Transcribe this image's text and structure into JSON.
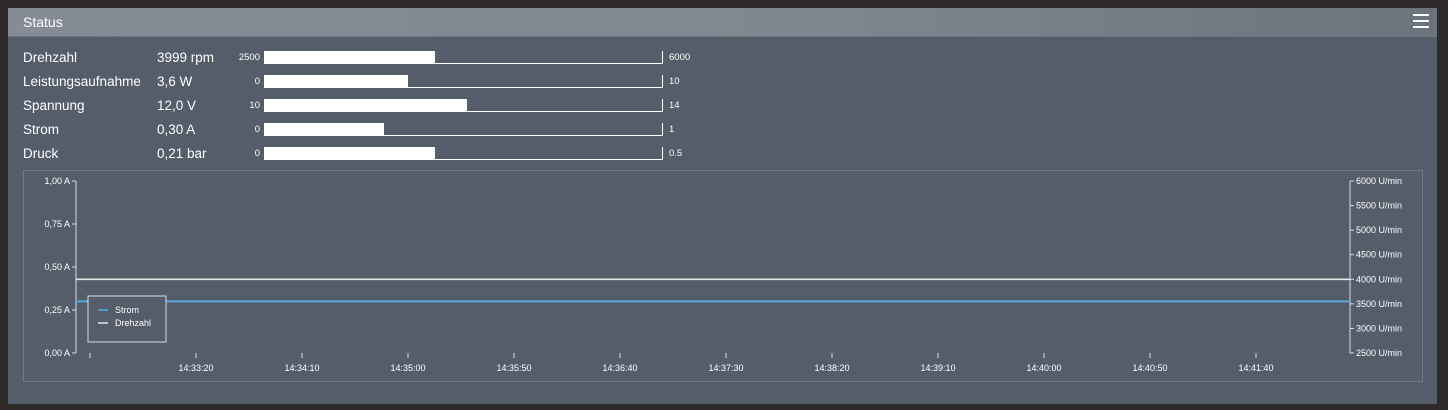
{
  "header": {
    "title": "Status",
    "menu_icon": "hamburger-menu-icon"
  },
  "status_rows": [
    {
      "label": "Drehzahl",
      "value": "3999 rpm",
      "min": "2500",
      "max": "6000",
      "level": 0.428
    },
    {
      "label": "Leistungsaufnahme",
      "value": "3,6 W",
      "min": "0",
      "max": "10",
      "level": 0.36
    },
    {
      "label": "Spannung",
      "value": "12,0 V",
      "min": "10",
      "max": "14",
      "level": 0.51
    },
    {
      "label": "Strom",
      "value": "0,30 A",
      "min": "0",
      "max": "1",
      "level": 0.3
    },
    {
      "label": "Druck",
      "value": "0,21 bar",
      "min": "0",
      "max": "0.5",
      "level": 0.428
    }
  ],
  "colors": {
    "panel_bg": "#545d69",
    "strom_line": "#5ba8e0",
    "drehzahl_line": "#e6e6e6"
  },
  "chart_data": {
    "type": "line",
    "x_ticks": [
      "14:33:20",
      "14:34:10",
      "14:35:00",
      "14:35:50",
      "14:36:40",
      "14:37:30",
      "14:38:20",
      "14:39:10",
      "14:40:00",
      "14:40:50",
      "14:41:40"
    ],
    "y_left": {
      "ticks": [
        "0,00 A",
        "0,25 A",
        "0,50 A",
        "0,75 A",
        "1,00 A"
      ],
      "range": [
        0,
        1
      ]
    },
    "y_right": {
      "ticks": [
        "2500 U/min",
        "3000 U/min",
        "3500 U/min",
        "4000 U/min",
        "4500 U/min",
        "5000 U/min",
        "5500 U/min",
        "6000 U/min"
      ],
      "range": [
        2500,
        6000
      ]
    },
    "series": [
      {
        "name": "Strom",
        "axis": "left",
        "color": "#5ba8e0",
        "values": [
          0.3,
          0.3,
          0.3,
          0.3,
          0.3,
          0.3,
          0.3,
          0.3,
          0.3,
          0.3,
          0.3,
          0.3
        ]
      },
      {
        "name": "Drehzahl",
        "axis": "right",
        "color": "#e6e6e6",
        "values": [
          3999,
          3999,
          3999,
          3999,
          3999,
          3999,
          3999,
          3999,
          3999,
          3999,
          3999,
          3999
        ]
      }
    ],
    "legend_position": "bottom-left",
    "grid": false
  }
}
